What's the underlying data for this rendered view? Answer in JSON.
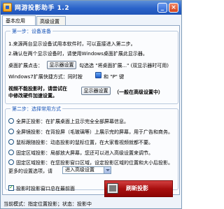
{
  "window": {
    "title": "网游投影助手 1.2",
    "minimize": "_",
    "close": "×"
  },
  "tabs": [
    {
      "label": "基本应用"
    },
    {
      "label": "高级设置"
    }
  ],
  "step1": {
    "legend": "第一步：设备准备",
    "line1": "1.来源两台显示设备试用本软件时，可以直接进入第二步。",
    "line2": "2.确认在两个显示设备时，请使用Windows桌面扩展此显示器。",
    "desktop_label": "桌面扩展点击：",
    "display_settings_btn": "显示器设置",
    "check_text": "勾选选 \"将桌面扩展...\" (双显示器时可用)",
    "shortcut_label": "Windows7扩展快捷方式：同时按",
    "shortcut_keys": "和 \"P\" 键",
    "note_line1": "视频不能投影时，请尝试在",
    "note_line2": "中修改硬件加速设置。",
    "display_settings_btn2": "显示器设置",
    "note_suffix": "（一般在高级设置中）"
  },
  "step2": {
    "legend": "第二步：选择常用方式",
    "options": [
      "全屏正投影：在扩展桌面上显示完全全部屏幕信息。",
      "全屏镜投影：在背投屏（毛玻璃等）上展示完的屏幕，用于广告和商务。",
      "鼠标跟随投影：动态投影的鼠标位置，在大家看视频就都不要。",
      "固定区域投影：局部放大屏幕，您还可以进入高级设置来调节。",
      "固定区域投影：在您投影窗口区域，设定投影区域的位置和大小后投影。"
    ],
    "more_settings_label": "更多的设置选项，请",
    "combo_value": "进入高级设置",
    "checkbox_label": "投影时投影窗口总在最前面",
    "refresh_btn": "刷新投影"
  },
  "status": {
    "text": "当前模式：指定位置投影；状态：投影中"
  }
}
